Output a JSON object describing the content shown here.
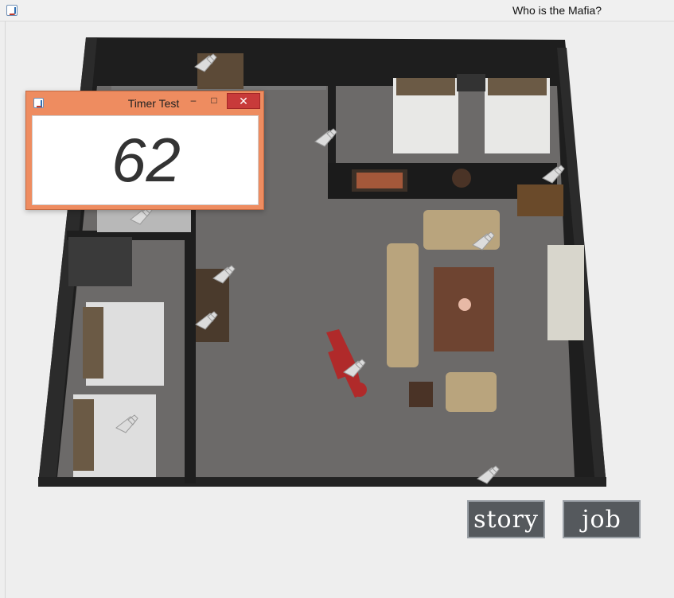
{
  "window": {
    "title": "Who is the Mafia?"
  },
  "timer_window": {
    "title": "Timer Test",
    "minimize_glyph": "–",
    "maximize_glyph": "□",
    "close_glyph": "✕",
    "value": "62"
  },
  "buttons": {
    "story": "story",
    "job": "job"
  },
  "icons": {
    "app": "java-cup-icon",
    "timer_app": "java-cup-icon",
    "map_marker": "pointer-hand-icon"
  },
  "colors": {
    "timer_frame": "#ee8c60",
    "close_button": "#c83a3a",
    "game_button_bg": "#55595d",
    "carpet": "#6c6a69",
    "walls": "#1e1e1e",
    "victim": "#b02a2a"
  }
}
